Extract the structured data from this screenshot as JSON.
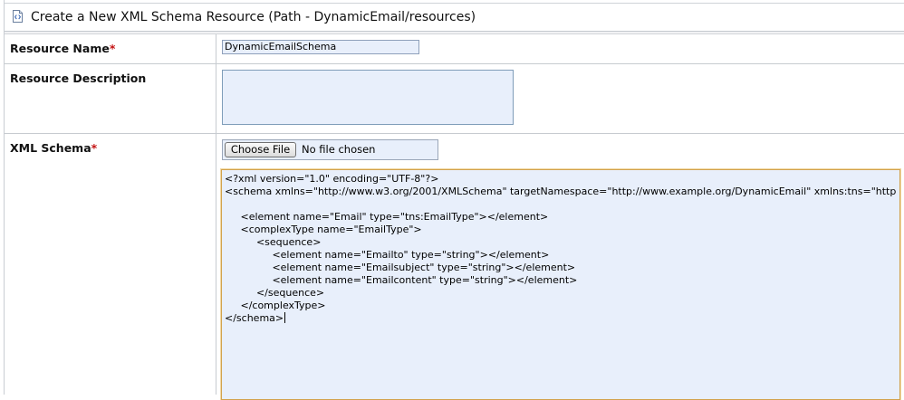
{
  "header": {
    "title": "Create a New XML Schema Resource (Path - DynamicEmail/resources)",
    "icon": "xml-document-icon"
  },
  "form": {
    "resource_name": {
      "label": "Resource Name",
      "required_mark": "*",
      "value": "DynamicEmailSchema"
    },
    "resource_description": {
      "label": "Resource Description",
      "value": ""
    },
    "xml_schema": {
      "label": "XML Schema",
      "required_mark": "*",
      "file_button_label": "Choose File",
      "file_status": "No file chosen",
      "content_lines": [
        "<?xml version=\"1.0\" encoding=\"UTF-8\"?>",
        "<schema xmlns=\"http://www.w3.org/2001/XMLSchema\" targetNamespace=\"http://www.example.org/DynamicEmail\" xmlns:tns=\"http",
        "",
        "     <element name=\"Email\" type=\"tns:EmailType\"></element>",
        "     <complexType name=\"EmailType\">",
        "          <sequence>",
        "               <element name=\"Emailto\" type=\"string\"></element>",
        "               <element name=\"Emailsubject\" type=\"string\"></element>",
        "               <element name=\"Emailcontent\" type=\"string\"></element>",
        "          </sequence>",
        "     </complexType>",
        "</schema>"
      ]
    }
  },
  "colors": {
    "required": "#c41212",
    "input_background": "#e8effb",
    "focus_border": "#d2a24c"
  }
}
